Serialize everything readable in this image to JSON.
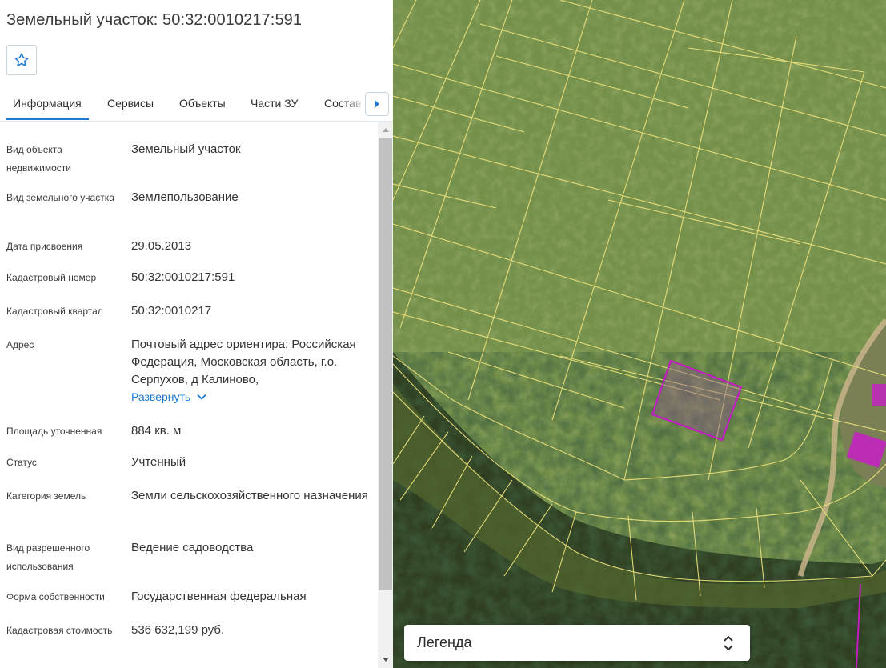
{
  "panel": {
    "title": "Земельный участок: 50:32:0010217:591",
    "favorite_icon": "star-outline-icon",
    "tabs": [
      {
        "label": "Информация",
        "active": true
      },
      {
        "label": "Сервисы"
      },
      {
        "label": "Объекты"
      },
      {
        "label": "Части ЗУ"
      },
      {
        "label": "Состав"
      }
    ],
    "tab_scroll_icon": "caret-right-icon",
    "fields": [
      {
        "label": "Вид объекта недвижимости",
        "value": "Земельный участок"
      },
      {
        "label": "Вид земельного участка",
        "value": "Землепользование"
      },
      {
        "label": "Дата присвоения",
        "value": "29.05.2013"
      },
      {
        "label": "Кадастровый номер",
        "value": "50:32:0010217:591"
      },
      {
        "label": "Кадастровый квартал",
        "value": "50:32:0010217"
      },
      {
        "label": "Адрес",
        "value": "Почтовый адрес ориентира: Российская Федерация, Московская область, г.о. Серпухов, д Калиново,",
        "expand_label": "Развернуть"
      },
      {
        "label": "Площадь уточненная",
        "value": "884 кв. м"
      },
      {
        "label": "Статус",
        "value": "Учтенный"
      },
      {
        "label": "Категория земель",
        "value": "Земли сельскохозяйственного назначения"
      },
      {
        "label": "Вид разрешенного использования",
        "value": "Ведение садоводства"
      },
      {
        "label": "Форма собственности",
        "value": "Государственная федеральная"
      },
      {
        "label": "Кадастровая стоимость",
        "value": "536 632,199 руб."
      }
    ]
  },
  "map": {
    "parcel_outline_color": "#f0e27a",
    "selected_parcel_color": "#b000b0",
    "legend": {
      "label": "Легенда",
      "toggle_icon": "chevron-up-down-icon"
    }
  },
  "colors": {
    "accent": "#1f78d1",
    "text": "#333333"
  }
}
